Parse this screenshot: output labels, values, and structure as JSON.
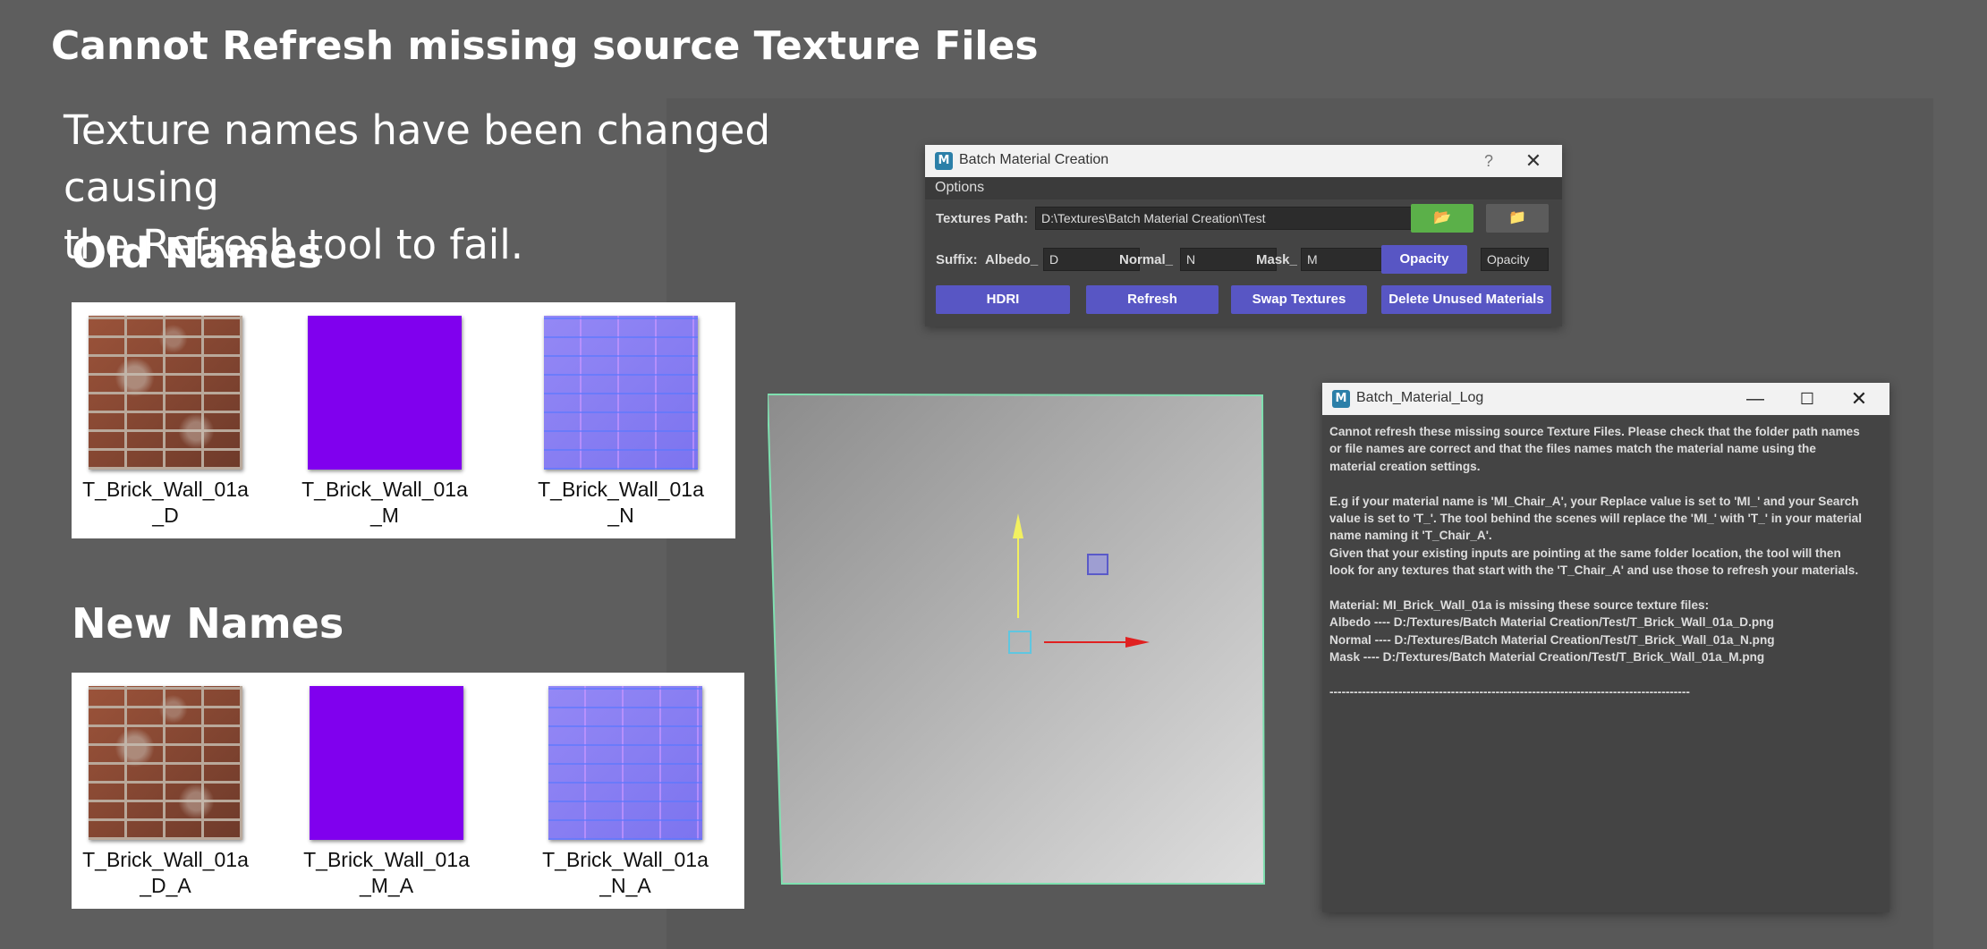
{
  "slide": {
    "title": "Cannot Refresh missing source Texture Files",
    "subtitle_lines": [
      "Texture names have been changed causing",
      "the Refresh tool to fail."
    ],
    "old_names_heading": "Old Names",
    "new_names_heading": "New Names"
  },
  "old_textures": [
    {
      "line1": "T_Brick_Wall_01a",
      "line2": "_D"
    },
    {
      "line1": "T_Brick_Wall_01a",
      "line2": "_M"
    },
    {
      "line1": "T_Brick_Wall_01a",
      "line2": "_N"
    }
  ],
  "new_textures": [
    {
      "line1": "T_Brick_Wall_01a",
      "line2": "_D_A"
    },
    {
      "line1": "T_Brick_Wall_01a",
      "line2": "_M_A"
    },
    {
      "line1": "T_Brick_Wall_01a",
      "line2": "_N_A"
    }
  ],
  "batch_window": {
    "icon_letter": "M",
    "title": "Batch Material Creation",
    "help_label": "?",
    "close_label": "✕",
    "menu_options": "Options",
    "textures_path_label": "Textures Path:",
    "textures_path_value": "D:\\Textures\\Batch Material Creation\\Test",
    "open_folder_icon": "📂",
    "browse_folder_icon": "📁",
    "suffix_label": "Suffix:",
    "albedo_label": "Albedo_",
    "albedo_value": "D",
    "normal_label": "Normal_",
    "normal_value": "N",
    "mask_label": "Mask_",
    "mask_value": "M",
    "opacity_button": "Opacity",
    "opacity_value": "Opacity",
    "hdri_button": "HDRI",
    "refresh_button": "Refresh",
    "swap_button": "Swap Textures",
    "delete_button": "Delete Unused Materials"
  },
  "log_window": {
    "icon_letter": "M",
    "title": "Batch_Material_Log",
    "minimize_label": "—",
    "maximize_label": "☐",
    "close_label": "✕",
    "para1": [
      "Cannot refresh these missing source Texture Files. Please check that the folder path names",
      "or file names are correct and that the files names match the material name using the",
      "material creation settings."
    ],
    "para2": [
      "E.g if your material name is 'MI_Chair_A', your Replace value is set to 'MI_' and your Search",
      "value is set to 'T_'. The tool behind the scenes will replace the 'MI_' with 'T_' in your material",
      "name naming it 'T_Chair_A'.",
      "Given that your existing inputs are pointing at the same folder location, the tool will then",
      "look for any textures that start with the 'T_Chair_A' and use those to refresh your materials."
    ],
    "para3": [
      "Material: MI_Brick_Wall_01a is missing these source  texture files:",
      "Albedo ---- D:/Textures/Batch Material Creation/Test/T_Brick_Wall_01a_D.png",
      "Normal ---- D:/Textures/Batch Material Creation/Test/T_Brick_Wall_01a_N.png",
      "Mask ---- D:/Textures/Batch Material Creation/Test/T_Brick_Wall_01a_M.png"
    ],
    "separator": "-----------------------------------------------------------------------------------------"
  },
  "colors": {
    "background": "#5e5e5e",
    "button_blue": "#5856c4",
    "button_green": "#5bb049",
    "gizmo_x": "#e02020",
    "gizmo_y": "#f2f060",
    "viewport_border": "#7fe0b0"
  }
}
